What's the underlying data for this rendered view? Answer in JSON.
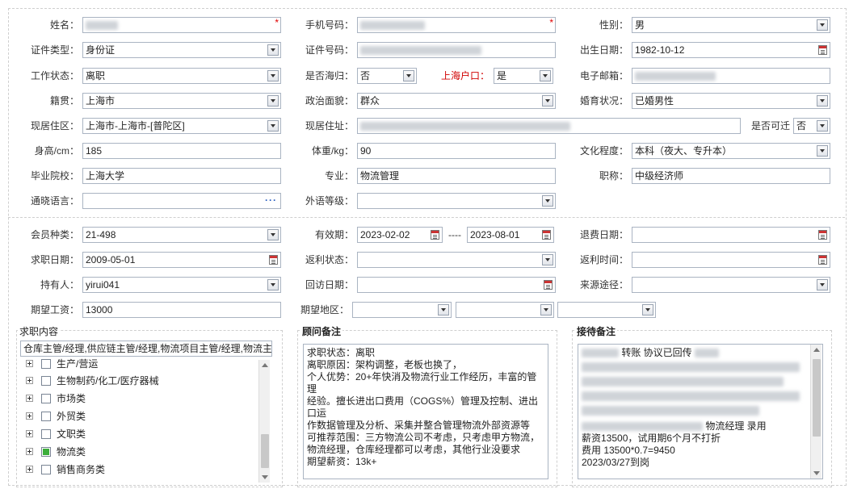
{
  "basic": {
    "name_label": "姓名：",
    "mobile_label": "手机号码：",
    "gender_label": "性别：",
    "gender_value": "男",
    "idtype_label": "证件类型：",
    "idtype_value": "身份证",
    "idno_label": "证件号码：",
    "birth_label": "出生日期：",
    "birth_value": "1982-10-12",
    "workstatus_label": "工作状态：",
    "workstatus_value": "离职",
    "returnee_label": "是否海归：",
    "returnee_value": "否",
    "hukou_label": "上海户口：",
    "hukou_value": "是",
    "email_label": "电子邮箱：",
    "native_label": "籍贯：",
    "native_value": "上海市",
    "political_label": "政治面貌：",
    "political_value": "群众",
    "marital_label": "婚育状况：",
    "marital_value": "已婚男性",
    "residence_label": "现居住区：",
    "residence_value": "上海市-上海市-[普陀区]",
    "address_label": "现居住址：",
    "relocate_label": "是否可迁",
    "relocate_value": "否",
    "height_label": "身高/cm：",
    "height_value": "185",
    "weight_label": "体重/kg：",
    "weight_value": "90",
    "education_label": "文化程度：",
    "education_value": "本科（夜大、专升本）",
    "school_label": "毕业院校：",
    "school_value": "上海大学",
    "major_label": "专业：",
    "major_value": "物流管理",
    "title_label": "职称：",
    "title_value": "中级经济师",
    "language_label": "通晓语言：",
    "foreign_label": "外语等级："
  },
  "member": {
    "type_label": "会员种类：",
    "type_value": "21-498",
    "valid_label": "有效期：",
    "valid_from": "2023-02-02",
    "valid_sep": "----",
    "valid_to": "2023-08-01",
    "refund_label": "退费日期：",
    "jobdate_label": "求职日期：",
    "jobdate_value": "2009-05-01",
    "rebate_status_label": "返利状态：",
    "rebate_time_label": "返利时间：",
    "holder_label": "持有人：",
    "holder_value": "yirui041",
    "visit_label": "回访日期：",
    "source_label": "来源途径：",
    "salary_label": "期望工资：",
    "salary_value": "13000",
    "area_label": "期望地区："
  },
  "job": {
    "title": "求职内容",
    "summary": "仓库主管/经理,供应链主管/经理,物流项目主管/经理,物流主",
    "tree": [
      {
        "label": "生产/营运",
        "checked": false
      },
      {
        "label": "生物制药/化工/医疗器械",
        "checked": false
      },
      {
        "label": "市场类",
        "checked": false
      },
      {
        "label": "外贸类",
        "checked": false
      },
      {
        "label": "文职类",
        "checked": false
      },
      {
        "label": "物流类",
        "checked": true
      },
      {
        "label": "销售商务类",
        "checked": false
      }
    ]
  },
  "advisor": {
    "title": "顾问备注",
    "lines": [
      "求职状态：离职",
      "离职原因：架构调整，老板也换了，",
      "个人优势：20+年快消及物流行业工作经历，丰富的管理",
      "经验。擅长进出口费用（COGS%）管理及控制、进出口运",
      "作数据管理及分析、采集并整合管理物流外部资源等",
      "可推荐范围：三方物流公司不考虑，只考虑甲方物流，",
      "物流经理，仓库经理都可以考虑，其他行业没要求",
      "期望薪资：13k+"
    ]
  },
  "reception": {
    "title": "接待备注",
    "line1": "转账 协议已回传",
    "line_role": "物流经理 录用",
    "line_salary": "薪资13500，试用期6个月不打折",
    "line_fee": "费用 13500*0.7=9450",
    "line_date": "2023/03/27到岗"
  }
}
